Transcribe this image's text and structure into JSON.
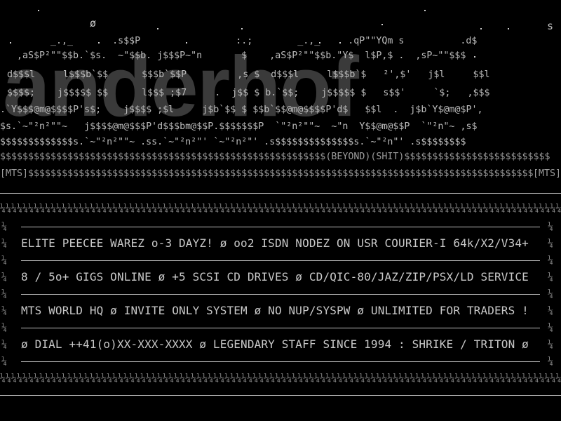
{
  "logo": {
    "text": "anderhof",
    "ascii_rows": [
      "  _.,_       .s$$P                 :.;        _.,_     .qP\"\"YQm s          .d$",
      ",aS$P²\"\"$$b.`$s.  ~\"$$b. j$$$P~\"n       $    ,aS$P²\"\"$$b.\"Y$  l$P,$ .  ,sP~\"\"$$$",
      "d$$$l     l$$$b`$$      $$$b`$$P         ,s $  d$$$l     l$$$b`$   ²',$'   j$l     $$l",
      "$$$$;    j$$$$$ $$      l$$$ ;$7     .  j$$ $ b.`$$;    j$$$$$ $   s$$'     `$;   ,$$$",
      ".`Y$$$@m@$$$$P's$;    j$$$$ ;$l     j$b`$$ $ $$b`$$@m@$$$$P'd$   $$l  .  j$b`Y$@m@$P',",
      "$s.`~\"²n²\"\"~   j$$$$@m@$$$P'd$$$bm@$$P.$$$$$$$P  `\"²n²\"\"~  ~\"n  Y$$@m@$$P  `\"²n\"~ ,s$",
      "$$$$$$$$$$$$$s.`~\"²n²\"\"~ .ss.`~\"²n²\"' `~\"²n²\"' .s$$$$$$$$$$$$$$s.`~\"²n\"' .s$$$$$$$$"
    ]
  },
  "banner": {
    "row1": "$$$$$$$$$$$$$$$$$$$$$$$$$$$$$$$$$$$$$$$$$$$$$$$$$$$$$$$$$$(BEYOND)(SHIT)$$$$$$$$$$$$$$$$$$$$$$$$$$",
    "row2_left_tag": "[MTS]",
    "row2_fill": "$$$$$$$$$$$$$$$$$$$$$$$$$$$$$$$$$$$$$$$$$$$$$$$$$$$$$$$$$$$$$$$$$$$$$$$$$$$$$$$$$$$$$$$$$$$",
    "row2_right_tag": "[MTS]"
  },
  "info": {
    "line1": "ELITE PEECEE WAREZ o-3 DAYZ! ø oo2 ISDN NODEZ ON USR COURIER-I 64k/X2/V34+",
    "line2": "8 / 5o+ GIGS ONLINE ø +5 SCSI CD DRIVES ø CD/QIC-80/JAZ/ZIP/PSX/LD SERVICE",
    "line3": "MTS WORLD HQ ø INVITE ONLY SYSTEM ø NO NUP/SYSPW ø UNLIMITED FOR TRADERS !",
    "line4": "ø DIAL ++41(o)XX-XXX-XXXX ø LEGENDARY STAFF SINCE 1994 : SHRIKE / TRITON ø"
  },
  "decor": {
    "hatch_char": "¼",
    "bullet_glyph": "ø",
    "top_s": "s"
  },
  "colors": {
    "background": "#000000",
    "text": "#c8c8c8",
    "shadow": "#3a3a3a"
  }
}
